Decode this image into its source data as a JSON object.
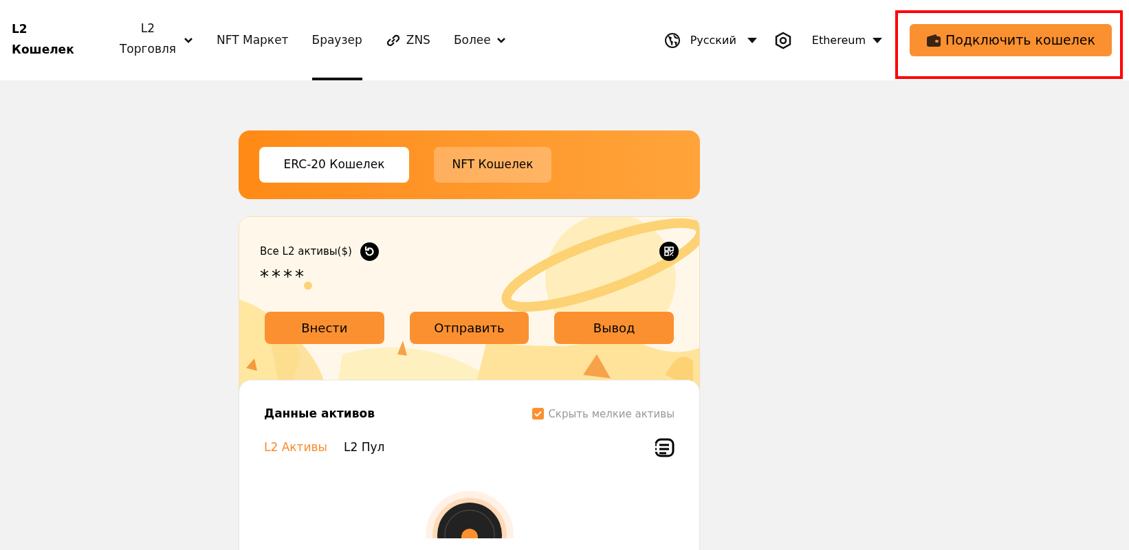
{
  "header": {
    "logo": [
      "L2",
      "Кошелек"
    ],
    "nav": [
      {
        "label": "L2 Торговля",
        "kind": "dropdown",
        "selected": false
      },
      {
        "label": "NFT Маркет",
        "kind": "link",
        "selected": false
      },
      {
        "label": "Браузер",
        "kind": "link",
        "selected": true
      },
      {
        "label": "ZNS",
        "kind": "icon-link",
        "selected": false
      },
      {
        "label": "Более",
        "kind": "dropdown",
        "selected": false
      }
    ],
    "language": "Русский",
    "network": "Ethereum",
    "connect_button": "Подключить кошелек"
  },
  "wallet_tabs": [
    {
      "label": "ERC-20 Кошелек",
      "selected": true
    },
    {
      "label": "NFT Кошелек",
      "selected": false
    }
  ],
  "assets_card": {
    "label": "Все L2 активы($)",
    "balance": "****",
    "actions": [
      "Внести",
      "Отправить",
      "Вывод"
    ]
  },
  "asset_data": {
    "title": "Данные активов",
    "hide_small": {
      "label": "Скрыть мелкие активы",
      "checked": true
    },
    "tabs": [
      {
        "label": "L2 Активы",
        "selected": true
      },
      {
        "label": "L2 Пул",
        "selected": false
      }
    ]
  }
}
